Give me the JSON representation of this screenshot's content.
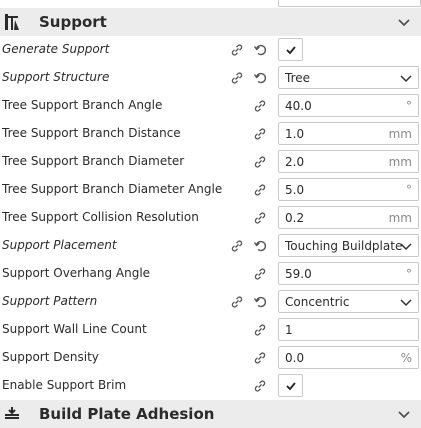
{
  "section": {
    "title": "Support",
    "icon": "support-icon",
    "next_title": "Build Plate Adhesion",
    "next_icon": "build-plate-adhesion-icon"
  },
  "settings": [
    {
      "label": "Generate Support",
      "type": "checkbox",
      "checked": true,
      "italic": true,
      "resettable": true
    },
    {
      "label": "Support Structure",
      "type": "select",
      "value": "Tree",
      "italic": true,
      "resettable": true
    },
    {
      "label": "Tree Support Branch Angle",
      "type": "number",
      "value": "40.0",
      "unit": "°"
    },
    {
      "label": "Tree Support Branch Distance",
      "type": "number",
      "value": "1.0",
      "unit": "mm"
    },
    {
      "label": "Tree Support Branch Diameter",
      "type": "number",
      "value": "2.0",
      "unit": "mm"
    },
    {
      "label": "Tree Support Branch Diameter Angle",
      "type": "number",
      "value": "5.0",
      "unit": "°"
    },
    {
      "label": "Tree Support Collision Resolution",
      "type": "number",
      "value": "0.2",
      "unit": "mm"
    },
    {
      "label": "Support Placement",
      "type": "select",
      "value": "Touching Buildplate",
      "italic": true,
      "resettable": true
    },
    {
      "label": "Support Overhang Angle",
      "type": "number",
      "value": "59.0",
      "unit": "°"
    },
    {
      "label": "Support Pattern",
      "type": "select",
      "value": "Concentric",
      "italic": true,
      "resettable": true
    },
    {
      "label": "Support Wall Line Count",
      "type": "number",
      "value": "1",
      "unit": ""
    },
    {
      "label": "Support Density",
      "type": "number",
      "value": "0.0",
      "unit": "%"
    },
    {
      "label": "Enable Support Brim",
      "type": "checkbox",
      "checked": true
    }
  ]
}
